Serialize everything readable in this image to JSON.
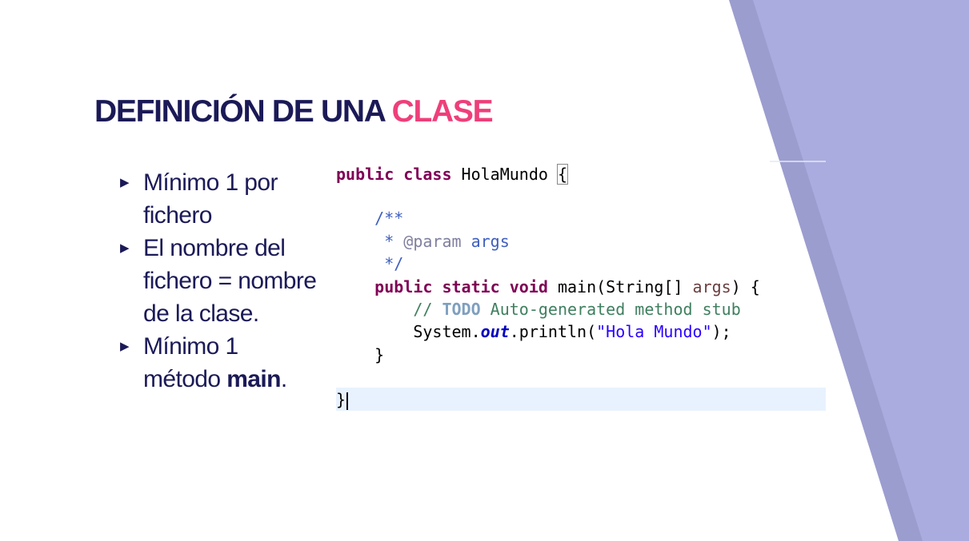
{
  "slide": {
    "title_main": "DEFINICIÓN DE UNA ",
    "title_accent": "CLASE",
    "bullets": [
      {
        "text": "Mínimo 1 por fichero"
      },
      {
        "text": "El nombre del fichero = nombre de la clase."
      },
      {
        "text": "Mínimo 1 método ",
        "bold": "main",
        "after": "."
      }
    ]
  },
  "code": {
    "l1_kw": "public class",
    "l1_name": " HolaMundo ",
    "l1_brace": "{",
    "l2": "    /**",
    "l3_pre": "     * ",
    "l3_ann": "@param",
    "l3_post": " args",
    "l4": "     */",
    "l5_kw": "    public static void",
    "l5_mid": " main(String[] ",
    "l5_arg": "args",
    "l5_end": ") {",
    "l6_pre": "        // ",
    "l6_todo": "TODO",
    "l6_post": " Auto-generated method stub",
    "l7_pre": "        System.",
    "l7_fld": "out",
    "l7_mid": ".println(",
    "l7_str": "\"Hola Mundo\"",
    "l7_end": ");",
    "l8": "    }",
    "l9": "}"
  },
  "colors": {
    "title": "#1b1a57",
    "accent": "#ee3f7a",
    "deco_dark": "#9b9dcf",
    "deco_light": "#aaacdf"
  }
}
